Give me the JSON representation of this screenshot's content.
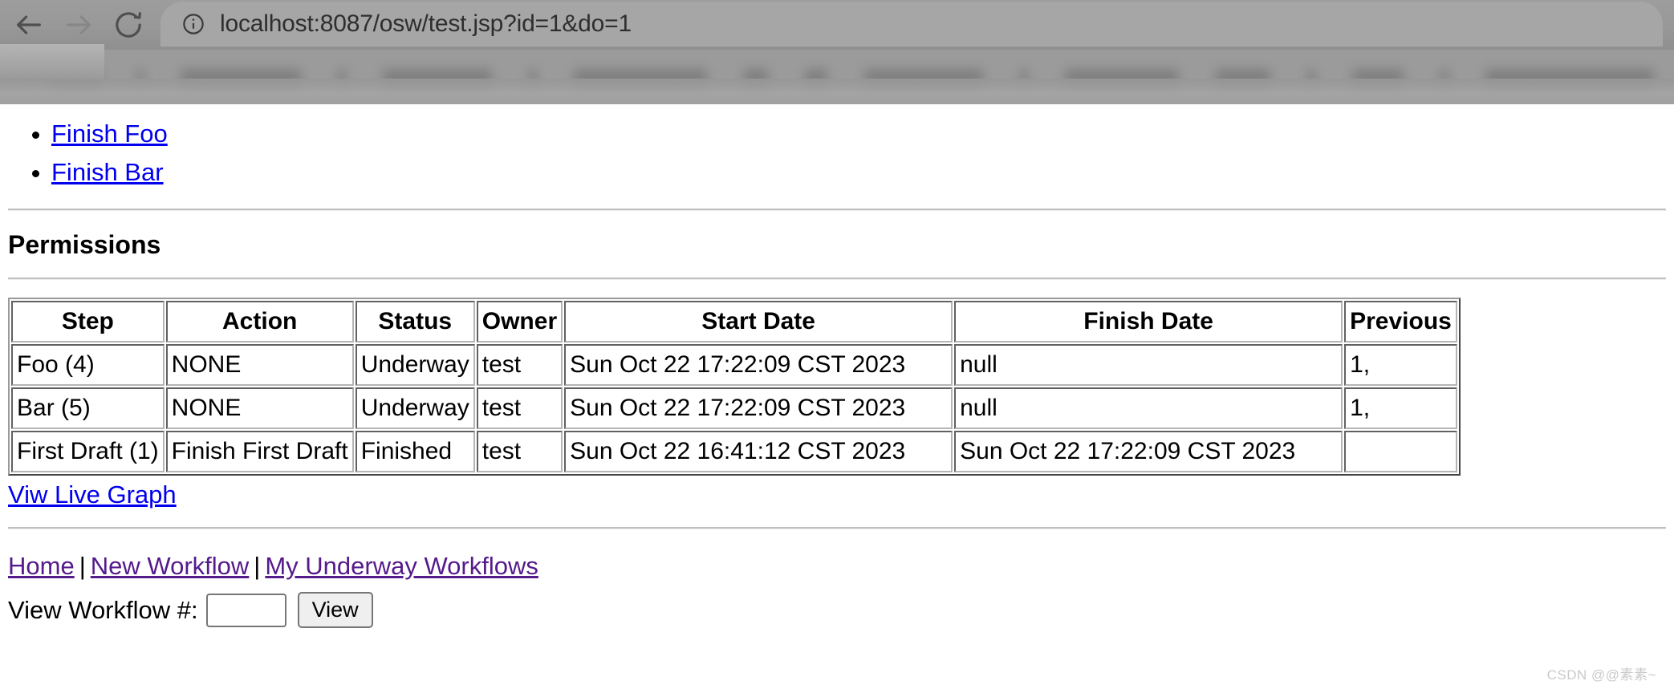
{
  "browser": {
    "back_label": "Back",
    "forward_label": "Forward",
    "reload_label": "Reload",
    "site_info_label": "View site information",
    "url": "localhost:8087/osw/test.jsp?id=1&do=1",
    "bookmarks_blurred": true
  },
  "page": {
    "actions": [
      {
        "label": "Finish Foo"
      },
      {
        "label": "Finish Bar"
      }
    ],
    "permissions_heading": "Permissions",
    "table": {
      "headers": [
        "Step",
        "Action",
        "Status",
        "Owner",
        "Start Date",
        "Finish Date",
        "Previous"
      ],
      "rows": [
        {
          "step": "Foo (4)",
          "action": "NONE",
          "status": "Underway",
          "owner": "test",
          "start_date": "Sun Oct 22 17:22:09 CST 2023",
          "finish_date": "null",
          "previous": "1,"
        },
        {
          "step": "Bar (5)",
          "action": "NONE",
          "status": "Underway",
          "owner": "test",
          "start_date": "Sun Oct 22 17:22:09 CST 2023",
          "finish_date": "null",
          "previous": "1,"
        },
        {
          "step": "First Draft (1)",
          "action": "Finish First Draft",
          "status": "Finished",
          "owner": "test",
          "start_date": "Sun Oct 22 16:41:12 CST 2023",
          "finish_date": "Sun Oct 22 17:22:09 CST 2023",
          "previous": ""
        }
      ]
    },
    "live_graph_link": "Viw Live Graph",
    "footer": {
      "home": "Home",
      "new_workflow": "New Workflow",
      "my_underway_workflows": "My Underway Workflows",
      "separator": "|"
    },
    "workflow_form": {
      "label": "View Workflow #:",
      "input_value": "",
      "button_label": "View"
    }
  },
  "watermark": "CSDN @@素素~",
  "colors": {
    "link_unvisited": "#0000ee",
    "link_visited": "#551a8b",
    "chrome_bg": "#9a9a9a",
    "page_bg": "#ffffff"
  }
}
